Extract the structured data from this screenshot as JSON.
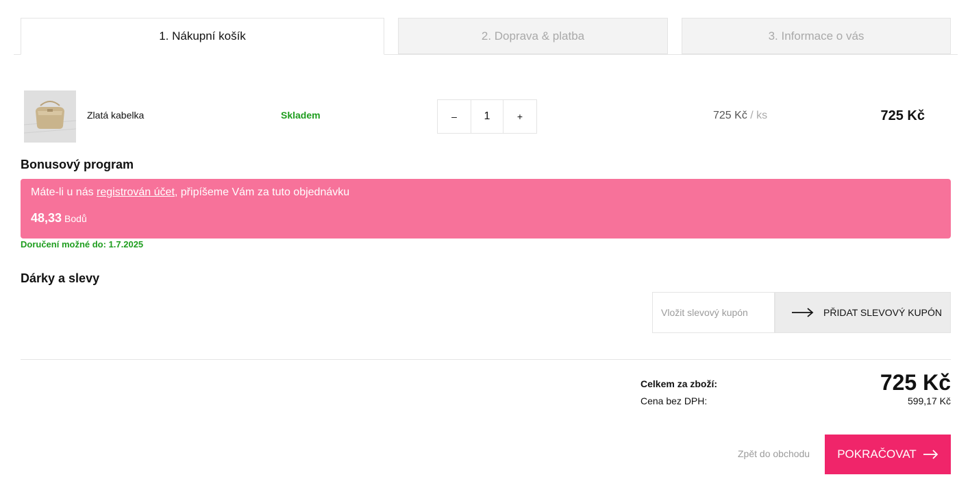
{
  "tabs": [
    {
      "label": "1. Nákupní košík"
    },
    {
      "label": "2. Doprava & platba"
    },
    {
      "label": "3. Informace o vás"
    }
  ],
  "cart_item": {
    "name": "Zlatá kabelka",
    "availability": "Skladem",
    "qty_minus": "–",
    "quantity": "1",
    "qty_plus": "+",
    "unit_price": "725 Kč",
    "unit_suffix": "/ ks",
    "total": "725 Kč"
  },
  "bonus": {
    "title": "Bonusový program",
    "text_before": "Máte-li u nás ",
    "link": "registrován účet",
    "text_after": ", připíšeme Vám za tuto objednávku",
    "points": "48,33",
    "points_unit": "Bodů"
  },
  "delivery_note": "Doručení možné do: 1.7.2025",
  "gifts": {
    "title": "Dárky a slevy",
    "coupon_placeholder": "Vložit slevový kupón",
    "coupon_button": "PŘIDAT SLEVOVÝ KUPÓN"
  },
  "totals": {
    "total_label": "Celkem za zboží:",
    "total_value": "725 Kč",
    "novat_label": "Cena bez DPH:",
    "novat_value": "599,17 Kč"
  },
  "actions": {
    "back": "Zpět do obchodu",
    "continue": "POKRAČOVAT"
  },
  "colors": {
    "accent": "#f0256a",
    "bonus_bg": "#f7729a",
    "in_stock": "#1e9d1e"
  }
}
